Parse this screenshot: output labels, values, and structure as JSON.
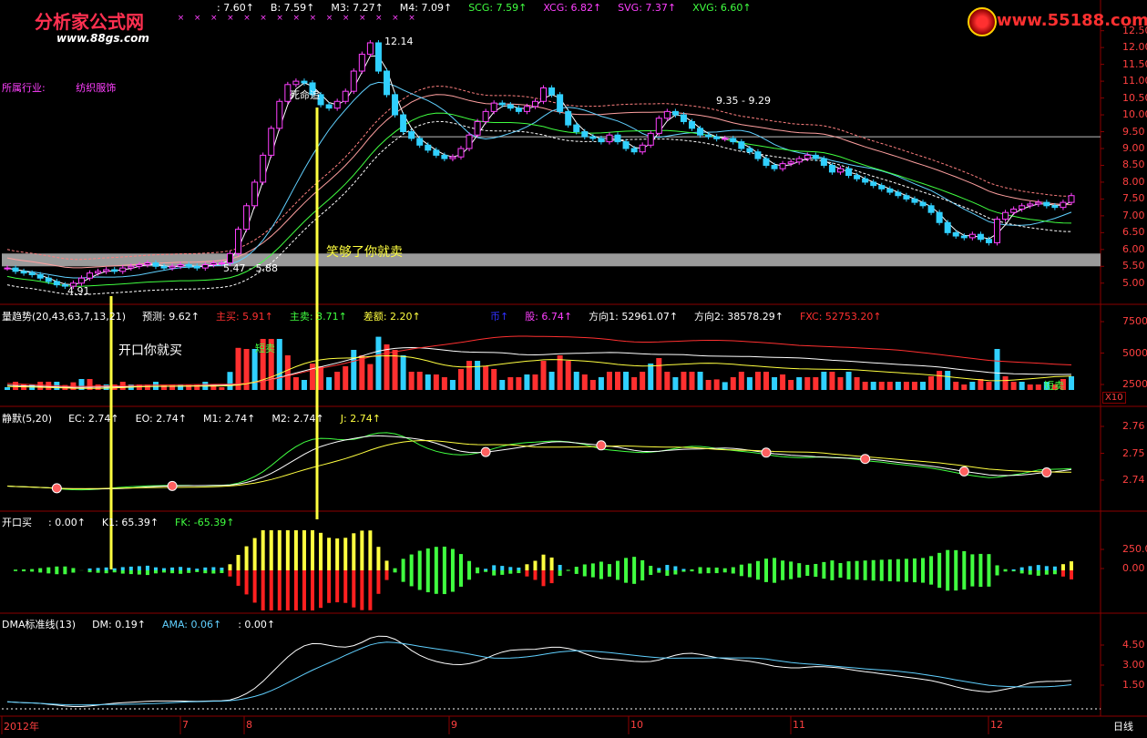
{
  "brand": {
    "left_name": "分析家公式网",
    "left_url": "www.88gs.com",
    "right_url": "www.55188.com"
  },
  "colors": {
    "bg": "#000000",
    "grid": "#8b0000",
    "up": "#ff3030",
    "down": "#30d0ff",
    "magenta": "#ff40ff",
    "yellow": "#ffff40",
    "green": "#40ff40",
    "axis_text": "#ff4040"
  },
  "panel1": {
    "header_values": [
      {
        "label": ": 7.60",
        "color": "#ffffff"
      },
      {
        "label": "B: 7.59",
        "color": "#ffffff"
      },
      {
        "label": "M3: 7.27",
        "color": "#ffffff"
      },
      {
        "label": "M4: 7.09",
        "color": "#ffffff"
      },
      {
        "label": "SCG: 7.59",
        "color": "#40ff40"
      },
      {
        "label": "XCG: 6.82",
        "color": "#ff40ff"
      },
      {
        "label": "SVG: 7.37",
        "color": "#ff40ff"
      },
      {
        "label": "XVG: 6.60",
        "color": "#40ff40"
      }
    ],
    "industry_label": "所属行业:",
    "industry_value": "纺织服饰",
    "annotation_dead": "死命追",
    "annotation_range_low": "5.47 - 5.88",
    "annotation_range_high": "9.35 - 9.29",
    "annotation_peak": "12.14",
    "annotation_low": "4.91",
    "band_text": "笑够了你就卖",
    "y_ticks": [
      "12.50",
      "12.00",
      "11.50",
      "11.00",
      "10.50",
      "10.00",
      "9.50",
      "9.00",
      "8.50",
      "8.00",
      "7.50",
      "7.00",
      "6.50",
      "6.00",
      "5.50",
      "5.00"
    ]
  },
  "panel2": {
    "title": "量趋势(20,43,63,7,13,21)",
    "values": [
      {
        "label": "预测: 9.62",
        "color": "#ffffff"
      },
      {
        "label": "主买: 5.91",
        "color": "#ff3030"
      },
      {
        "label": "主卖: 3.71",
        "color": "#40ff40"
      },
      {
        "label": "差额: 2.20",
        "color": "#ffff40"
      }
    ],
    "values_right": [
      {
        "label": "币",
        "color": "#3030ff"
      },
      {
        "label": "股: 6.74",
        "color": "#ff40ff"
      },
      {
        "label": "方向1: 52961.07",
        "color": "#ffffff"
      },
      {
        "label": "方向2: 38578.29",
        "color": "#ffffff"
      },
      {
        "label": "FXC: 52753.20",
        "color": "#ff3030"
      }
    ],
    "annotation_open": "开口你就买",
    "annotation_short": "短卖",
    "annotation_short2": "短卖",
    "scale_badge": "X10",
    "y_ticks": [
      "75000",
      "50000",
      "25000"
    ]
  },
  "panel3": {
    "title": "静默(5,20)",
    "values": [
      {
        "label": "EC: 2.74",
        "color": "#ffffff"
      },
      {
        "label": "EO: 2.74",
        "color": "#ffffff"
      },
      {
        "label": "M1: 2.74",
        "color": "#ffffff"
      },
      {
        "label": "M2: 2.74",
        "color": "#ffffff"
      },
      {
        "label": "J: 2.74",
        "color": "#ffff40"
      }
    ],
    "y_ticks": [
      "2.76",
      "2.75",
      "2.74"
    ]
  },
  "panel4": {
    "title": "开口买",
    "values": [
      {
        "label": ": 0.00",
        "color": "#ffffff"
      },
      {
        "label": "K1: 65.39",
        "color": "#ffffff"
      },
      {
        "label": "FK: -65.39",
        "color": "#40ff40"
      }
    ],
    "y_ticks": [
      "250.00",
      "0.00"
    ]
  },
  "panel5": {
    "title": "DMA标准线(13)",
    "values": [
      {
        "label": "DM: 0.19",
        "color": "#ffffff"
      },
      {
        "label": "AMA: 0.06",
        "color": "#60d0ff"
      },
      {
        "label": ": 0.00",
        "color": "#ffffff"
      }
    ],
    "y_ticks": [
      "4.50",
      "3.00",
      "1.50"
    ]
  },
  "x_axis": {
    "labels": [
      "2012年",
      "7",
      "8",
      "9",
      "10",
      "11",
      "12"
    ],
    "period": "日线"
  },
  "chart_data": {
    "type": "candlestick",
    "title": "",
    "xlabel": "",
    "ylabel": "",
    "x_categories": [
      "2012年",
      "7",
      "8",
      "9",
      "10",
      "11",
      "12"
    ],
    "ylim": [
      4.75,
      12.6
    ],
    "series": [
      {
        "values": [
          5.45,
          5.35,
          5.3,
          5.25,
          5.15,
          5.05,
          4.95,
          4.91,
          5.0,
          5.15,
          5.3,
          5.35,
          5.4,
          5.35,
          5.45,
          5.5,
          5.55,
          5.6,
          5.5,
          5.45,
          5.5,
          5.55,
          5.5,
          5.45,
          5.55,
          5.6,
          5.6,
          5.88,
          6.6,
          7.3,
          8.0,
          8.8,
          9.6,
          10.4,
          10.9,
          11.0,
          10.95,
          10.6,
          10.3,
          10.2,
          10.4,
          10.7,
          11.3,
          11.8,
          12.14,
          11.3,
          10.6,
          10.0,
          9.5,
          9.3,
          9.1,
          8.95,
          8.8,
          8.7,
          8.75,
          9.0,
          9.4,
          9.8,
          10.1,
          10.35,
          10.3,
          10.2,
          10.1,
          10.25,
          10.4,
          10.8,
          10.6,
          10.1,
          9.7,
          9.5,
          9.35,
          9.3,
          9.2,
          9.4,
          9.2,
          9.0,
          8.9,
          9.1,
          9.45,
          9.9,
          10.1,
          10.0,
          9.8,
          9.6,
          9.4,
          9.35,
          9.29,
          9.3,
          9.2,
          9.0,
          8.9,
          8.7,
          8.5,
          8.4,
          8.55,
          8.6,
          8.7,
          8.8,
          8.7,
          8.5,
          8.3,
          8.4,
          8.2,
          8.1,
          8.0,
          7.9,
          7.8,
          7.7,
          7.6,
          7.5,
          7.4,
          7.3,
          7.1,
          6.8,
          6.5,
          6.4,
          6.35,
          6.45,
          6.3,
          6.2,
          6.9,
          7.1,
          7.2,
          7.3,
          7.35,
          7.4,
          7.3,
          7.25,
          7.4,
          7.6
        ]
      }
    ]
  }
}
